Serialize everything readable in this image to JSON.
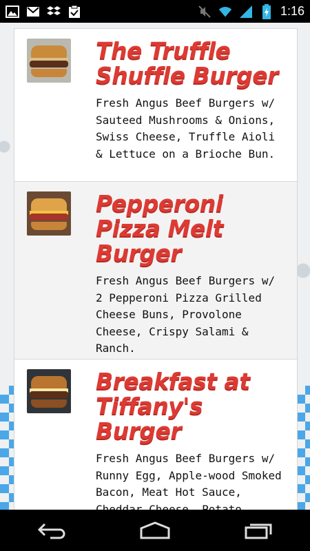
{
  "status_bar": {
    "time": "1:16",
    "icons": [
      "gallery-icon",
      "gmail-icon",
      "dropbox-icon",
      "clipboard-check-icon",
      "mute-icon",
      "wifi-icon",
      "signal-icon",
      "battery-icon"
    ]
  },
  "menu": {
    "items": [
      {
        "title": "The Truffle Shuffle Burger",
        "description": "Fresh Angus Beef Burgers w/ Sauteed Mushrooms & Onions, Swiss Cheese, Truffle Aioli & Lettuce on a Brioche Bun."
      },
      {
        "title": "Pepperoni Pizza Melt Burger",
        "description": "Fresh Angus Beef Burgers w/ 2 Pepperoni Pizza Grilled Cheese Buns, Provolone Cheese, Crispy Salami & Ranch."
      },
      {
        "title": "Breakfast at Tiffany's Burger",
        "description": "Fresh Angus Beef Burgers w/ Runny Egg, Apple-wood Smoked Bacon, Meat Hot Sauce, Cheddar Cheese, Potato"
      }
    ]
  },
  "nav": {
    "buttons": [
      "back-icon",
      "home-icon",
      "recent-apps-icon"
    ]
  },
  "colors": {
    "title_red": "#dd3a33",
    "status_bar": "#000000",
    "nav_bar": "#000000",
    "accent_blue": "#33b5e5"
  }
}
